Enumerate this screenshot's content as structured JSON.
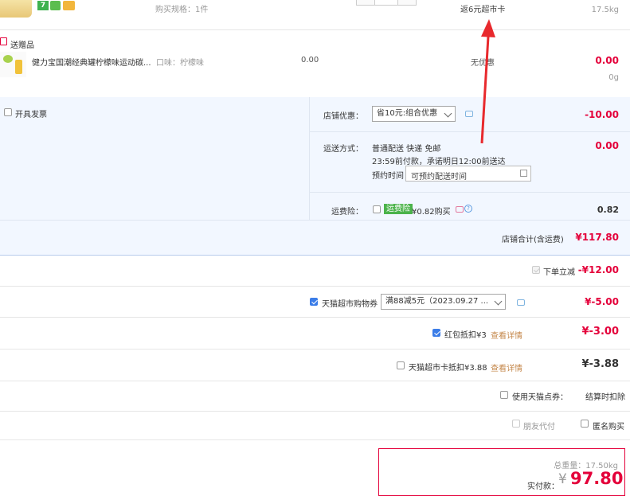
{
  "item_top": {
    "spec_label": "购买规格：1件",
    "promo_text": "返6元超市卡",
    "weight": "17.5kg"
  },
  "gift": {
    "section_label": "送赠品",
    "name": "健力宝国潮经典罐柠檬味运动碳...",
    "flavor": "口味：柠檬味",
    "unit_price": "0.00",
    "discount": "无优惠",
    "price": "0.00",
    "weight": "0g"
  },
  "store": {
    "invoice_label": "开具发票",
    "coupon_label": "店铺优惠：",
    "coupon_select": "省10元:组合优惠",
    "coupon_amount": "-10.00",
    "shipping_label": "运送方式：",
    "shipping_line1": "普通配送 快递 免邮",
    "shipping_line2": "23:59前付款，承诺明日12:00前送达",
    "appointment_label": "预约时间",
    "appointment_placeholder": "可预约配送时间",
    "shipping_amount": "0.00",
    "insurance_label": "运费险：",
    "insurance_badge": "运费险",
    "insurance_price": "¥0.82购买",
    "insurance_amount": "0.82",
    "subtotal_label": "店铺合计(含运费)",
    "subtotal_amount": "¥117.80"
  },
  "discounts": {
    "instant_label": "下单立减",
    "instant_amount": "-¥12.00",
    "tmall_coupon_label": "天猫超市购物券",
    "tmall_coupon_select": "满88减5元（2023.09.27 ...",
    "tmall_coupon_amount": "¥-5.00",
    "redpacket_label": "红包抵扣¥3",
    "redpacket_details": "查看详情",
    "redpacket_amount": "¥-3.00",
    "card_label": "天猫超市卡抵扣¥3.88",
    "card_details": "查看详情",
    "card_amount": "¥-3.88",
    "points_label": "使用天猫点券：",
    "points_value": "结算时扣除",
    "friend_pay_label": "朋友代付",
    "anonymous_label": "匿名购买"
  },
  "summary": {
    "total_weight": "总重量：17.50kg",
    "actual_label": "实付款：",
    "currency": "¥",
    "actual_amount": "97.80"
  },
  "colors": {
    "accent": "#e4003a",
    "store_bg": "#f2f7ff",
    "arrow": "#e8292d"
  }
}
